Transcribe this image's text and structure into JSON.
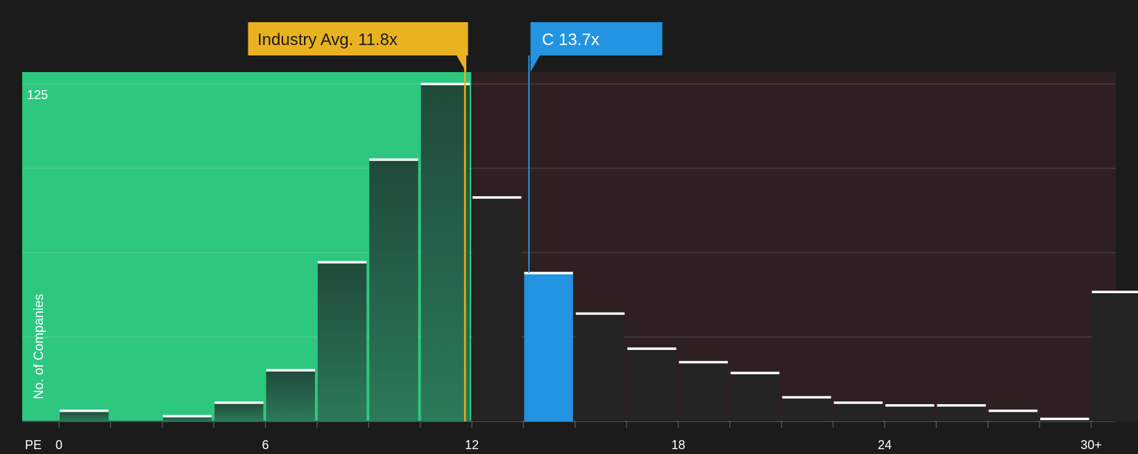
{
  "chart_data": {
    "type": "bar",
    "x_axis_label": "PE",
    "y_axis_label": "No. of Companies",
    "y_tick_label": "125",
    "x_ticks": [
      {
        "value": 0,
        "label": "0"
      },
      {
        "value": 6,
        "label": "6"
      },
      {
        "value": 12,
        "label": "12"
      },
      {
        "value": 18,
        "label": "18"
      },
      {
        "value": 24,
        "label": "24"
      },
      {
        "value": 30,
        "label": "30+"
      }
    ],
    "xlim": [
      0,
      30.75
    ],
    "ylim": [
      0,
      125
    ],
    "bin_width": 1.5,
    "bins": [
      {
        "start": 0.0,
        "value": 4
      },
      {
        "start": 1.5,
        "value": 0
      },
      {
        "start": 3.0,
        "value": 2
      },
      {
        "start": 4.5,
        "value": 7
      },
      {
        "start": 6.0,
        "value": 19
      },
      {
        "start": 7.5,
        "value": 59
      },
      {
        "start": 9.0,
        "value": 97
      },
      {
        "start": 10.5,
        "value": 125
      },
      {
        "start": 12.0,
        "value": 83
      },
      {
        "start": 13.5,
        "value": 55,
        "highlight": true
      },
      {
        "start": 15.0,
        "value": 40
      },
      {
        "start": 16.5,
        "value": 27
      },
      {
        "start": 18.0,
        "value": 22
      },
      {
        "start": 19.5,
        "value": 18
      },
      {
        "start": 21.0,
        "value": 9
      },
      {
        "start": 22.5,
        "value": 7
      },
      {
        "start": 24.0,
        "value": 6
      },
      {
        "start": 25.5,
        "value": 6
      },
      {
        "start": 27.0,
        "value": 4
      },
      {
        "start": 28.5,
        "value": 1
      },
      {
        "start": 30.0,
        "value": 48
      }
    ],
    "industry_avg": {
      "value": 11.8,
      "label": "Industry Avg. 11.8x"
    },
    "company": {
      "value": 13.7,
      "label": "C 13.7x"
    },
    "colors": {
      "background": "#1b1b1c",
      "undervalued_zone": "#2ec780",
      "overvalued_zone": "#2e1f20",
      "industry_marker": "#eab220",
      "company_marker": "#2394e1",
      "bar_dark": "#242424",
      "bar_cap": "#ffffff"
    }
  }
}
